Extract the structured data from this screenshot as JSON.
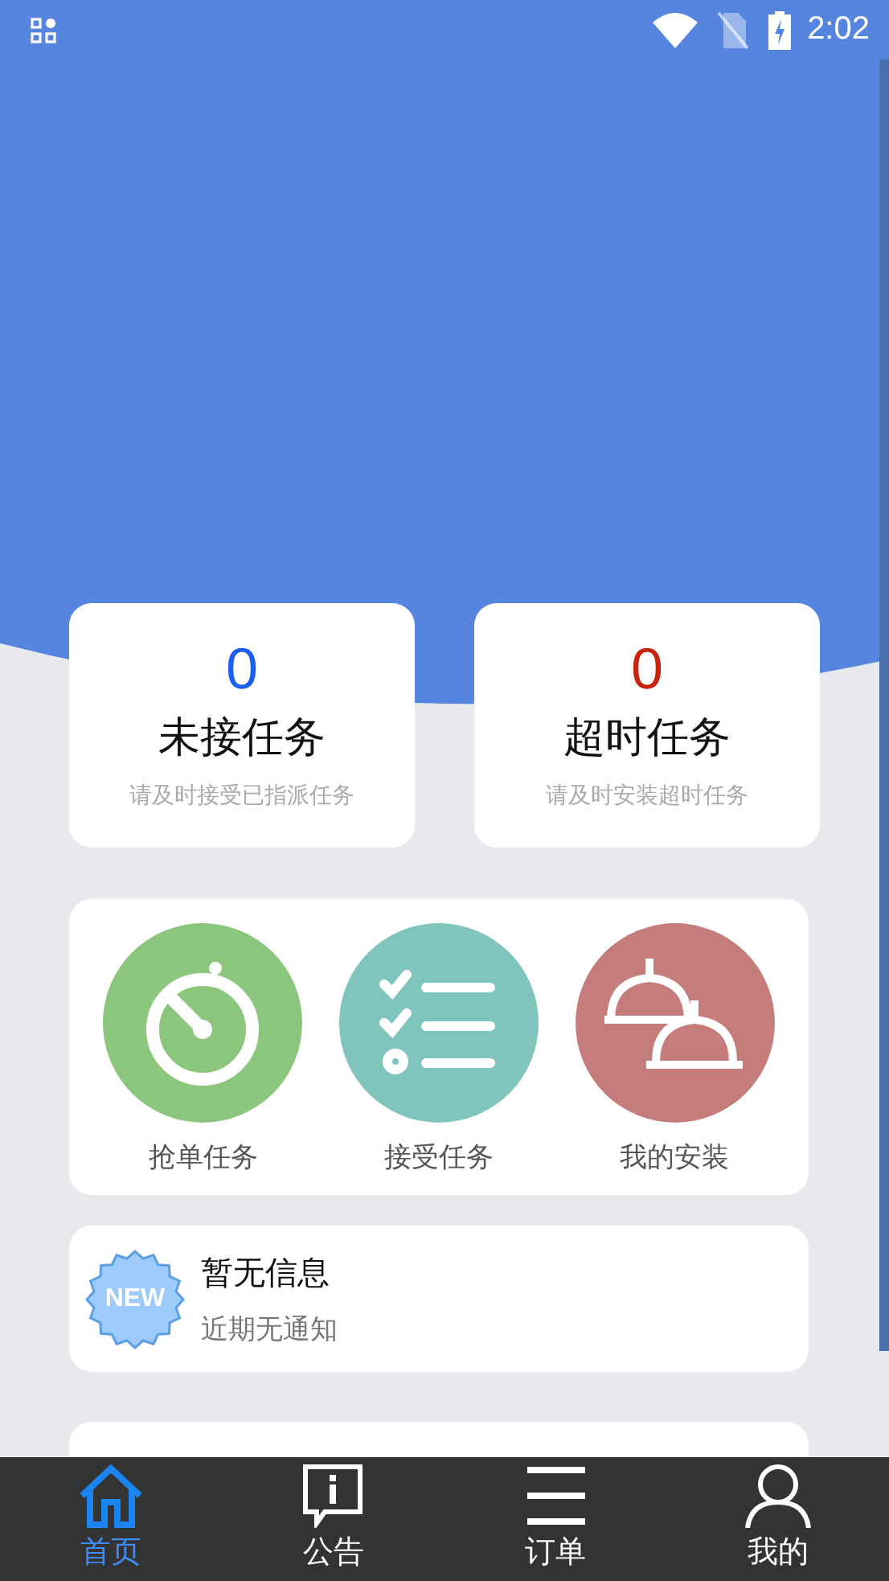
{
  "status_bar": {
    "time": "2:02"
  },
  "stat_cards": [
    {
      "count": "0",
      "color": "#1a5ff0",
      "title": "未接任务",
      "hint": "请及时接受已指派任务"
    },
    {
      "count": "0",
      "color": "#c8230f",
      "title": "超时任务",
      "hint": "请及时安装超时任务"
    }
  ],
  "shortcuts": [
    {
      "label": "抢单任务",
      "kind": "timer",
      "color": "#8cc57c"
    },
    {
      "label": "接受任务",
      "kind": "checklist",
      "color": "#80c5bd"
    },
    {
      "label": "我的安装",
      "kind": "domes",
      "color": "#c57d7b"
    }
  ],
  "notices": [
    {
      "badge": "NEW",
      "title": "暂无信息",
      "subtitle": "近期无通知"
    }
  ],
  "tabs": [
    {
      "label": "首页",
      "kind": "home",
      "selected": true
    },
    {
      "label": "公告",
      "kind": "notice",
      "selected": false
    },
    {
      "label": "订单",
      "kind": "list",
      "selected": false
    },
    {
      "label": "我的",
      "kind": "person",
      "selected": false
    }
  ]
}
